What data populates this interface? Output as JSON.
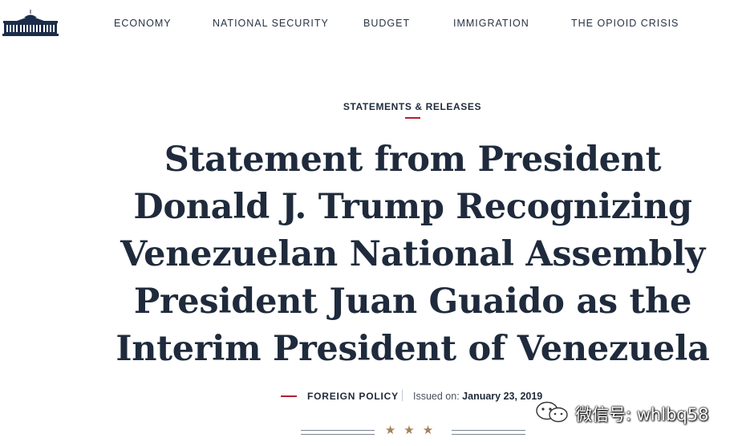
{
  "nav": {
    "logo_icon": "white-house-logo",
    "items": [
      {
        "label": "ECONOMY"
      },
      {
        "label": "NATIONAL SECURITY"
      },
      {
        "label": "BUDGET"
      },
      {
        "label": "IMMIGRATION"
      },
      {
        "label": "THE OPIOID CRISIS"
      }
    ]
  },
  "article": {
    "category": "STATEMENTS & RELEASES",
    "title": "Statement from President Donald J. Trump Recognizing Venezuelan National Assembly President Juan Guaido as the Interim President of Venezuela",
    "topic": "FOREIGN POLICY",
    "issued_label": "Issued on:",
    "issued_date": "January 23, 2019",
    "divider_icon": "three-stars"
  },
  "watermark": {
    "icon": "wechat-icon",
    "text": "微信号: whlbq58"
  },
  "colors": {
    "navy": "#1f2b3c",
    "accent_red": "#b3202f",
    "star_gold": "#a4825a"
  }
}
